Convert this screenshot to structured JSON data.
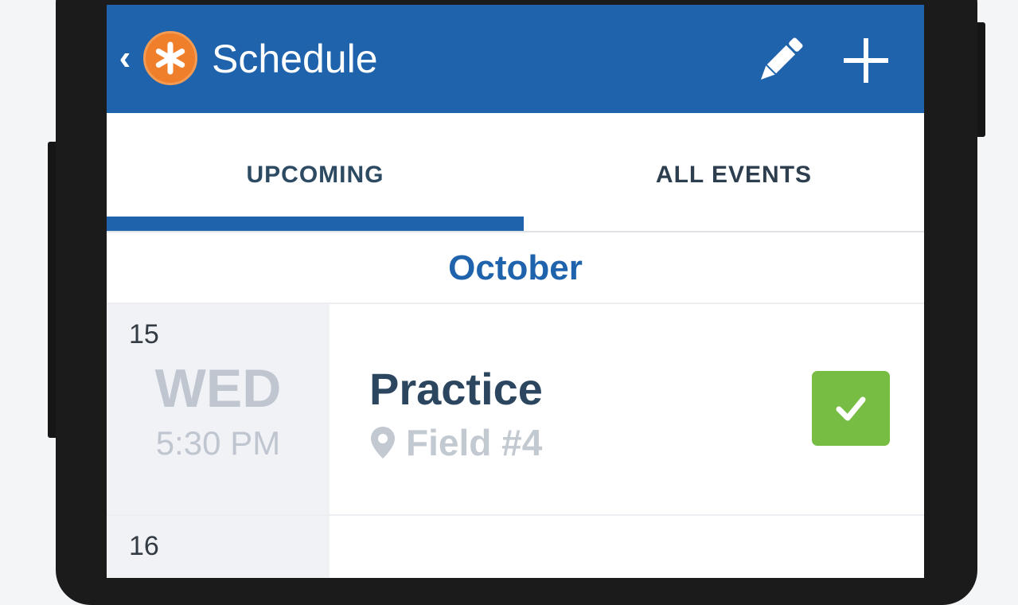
{
  "header": {
    "back_glyph": "‹",
    "title": "Schedule",
    "logo_glyph": "✱",
    "brand_color": "#1f63ad",
    "logo_color": "#f07f2b"
  },
  "tabs": [
    {
      "label": "UPCOMING",
      "selected": true
    },
    {
      "label": "ALL EVENTS",
      "selected": false
    }
  ],
  "month": "October",
  "events": [
    {
      "day_num": "15",
      "weekday": "WED",
      "time": "5:30 PM",
      "name": "Practice",
      "location": "Field #4",
      "rsvp": "accepted",
      "rsvp_color": "#77bd43"
    },
    {
      "day_num": "16"
    }
  ],
  "icons": {
    "edit": "pencil-icon",
    "add": "plus-icon",
    "location": "map-pin-icon",
    "rsvp": "checkmark-icon"
  }
}
